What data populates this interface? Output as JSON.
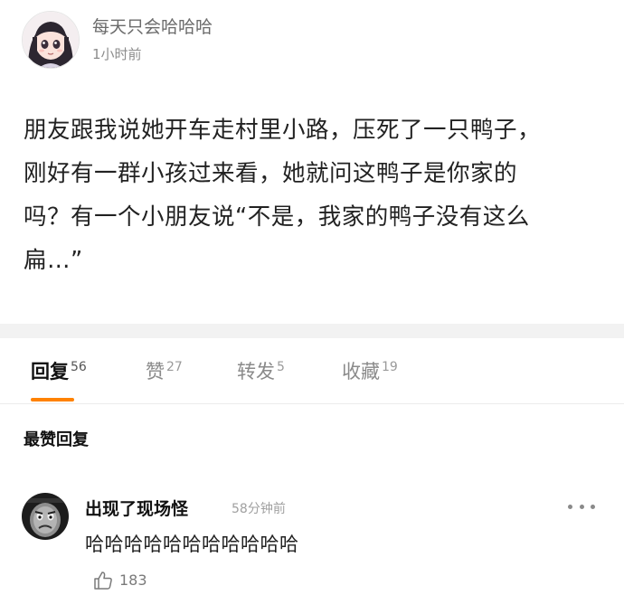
{
  "post": {
    "author": "每天只会哈哈哈",
    "time": "1小时前",
    "lines": [
      "朋友跟我说她开车走村里小路，压死了一只鸭子，",
      "刚好有一群小孩过来看，她就问这鸭子是你家的",
      "吗？有一个小朋友说“不是，我家的鸭子没有这么",
      "扁…”"
    ]
  },
  "tabs": [
    {
      "label": "回复",
      "count": "56"
    },
    {
      "label": "赞",
      "count": "27"
    },
    {
      "label": "转发",
      "count": "5"
    },
    {
      "label": "收藏",
      "count": "19"
    }
  ],
  "section_title": "最赞回复",
  "comment": {
    "user": "出现了现场怪",
    "time": "58分钟前",
    "text": "哈哈哈哈哈哈哈哈哈哈哈",
    "likes": "183"
  },
  "colors": {
    "accent": "#ff8200",
    "divider": "#f2f2f2"
  },
  "icons": {
    "more": "more-dots-icon",
    "like": "thumbs-up-icon"
  }
}
